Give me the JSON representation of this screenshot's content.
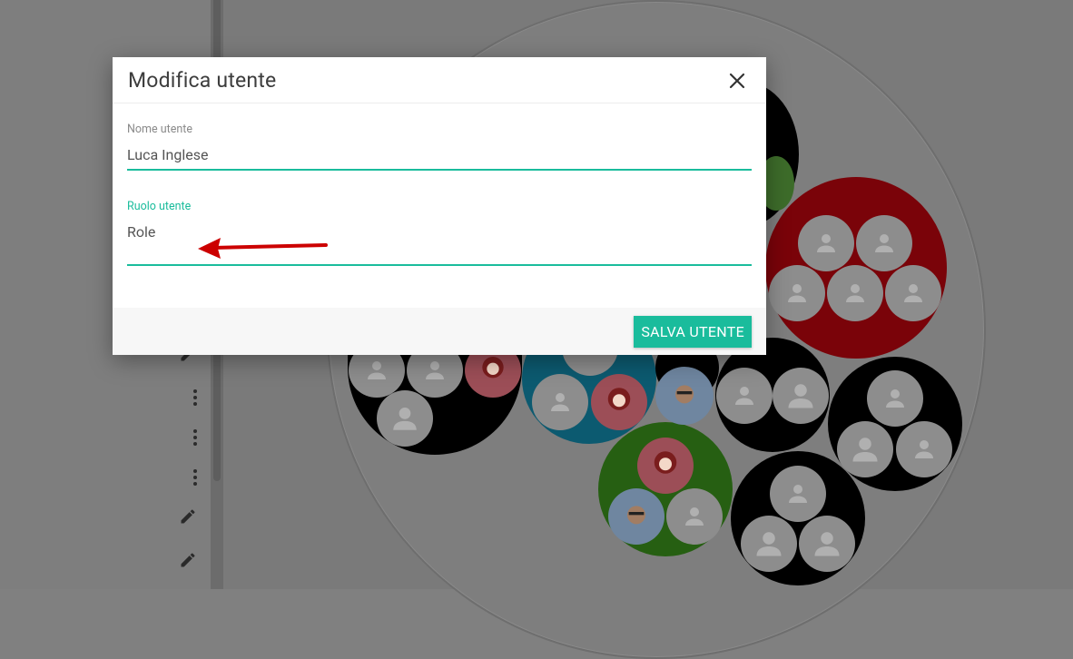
{
  "dialog": {
    "title": "Modifica utente",
    "fields": [
      {
        "label": "Nome utente",
        "value": "Luca Inglese"
      },
      {
        "label": "Ruolo utente",
        "value": "Role"
      }
    ],
    "save_label": "SALVA UTENTE"
  },
  "colors": {
    "accent": "#1abc9c",
    "team_red": "#e30613",
    "team_black": "#000000",
    "team_cyan": "#18b5e0",
    "team_green": "#4cc227",
    "annotation_arrow": "#cc0000"
  },
  "icons": {
    "close": "close-icon",
    "row_actions": [
      "more-vert-icon",
      "more-vert-icon",
      "more-vert-icon",
      "pencil-icon",
      "pencil-icon",
      "pencil-icon"
    ],
    "member_placeholder": "person-icon"
  }
}
